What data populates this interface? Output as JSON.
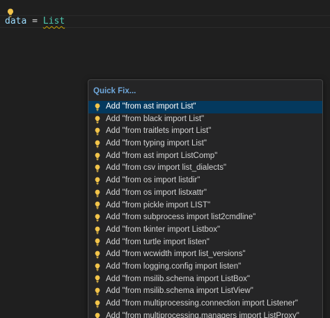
{
  "editor": {
    "code": {
      "var": "data",
      "op": " = ",
      "type": "List"
    },
    "lightbulb_icon": "lightbulb-icon",
    "warning_color": "#cca700"
  },
  "quickfix": {
    "title": "Quick Fix...",
    "selected_index": 0,
    "items": [
      {
        "label": "Add \"from ast import List\"",
        "icon": "lightbulb-icon"
      },
      {
        "label": "Add \"from black import List\"",
        "icon": "lightbulb-icon"
      },
      {
        "label": "Add \"from traitlets import List\"",
        "icon": "lightbulb-icon"
      },
      {
        "label": "Add \"from typing import List\"",
        "icon": "lightbulb-icon"
      },
      {
        "label": "Add \"from ast import ListComp\"",
        "icon": "lightbulb-icon"
      },
      {
        "label": "Add \"from csv import list_dialects\"",
        "icon": "lightbulb-icon"
      },
      {
        "label": "Add \"from os import listdir\"",
        "icon": "lightbulb-icon"
      },
      {
        "label": "Add \"from os import listxattr\"",
        "icon": "lightbulb-icon"
      },
      {
        "label": "Add \"from pickle import LIST\"",
        "icon": "lightbulb-icon"
      },
      {
        "label": "Add \"from subprocess import list2cmdline\"",
        "icon": "lightbulb-icon"
      },
      {
        "label": "Add \"from tkinter import Listbox\"",
        "icon": "lightbulb-icon"
      },
      {
        "label": "Add \"from turtle import listen\"",
        "icon": "lightbulb-icon"
      },
      {
        "label": "Add \"from wcwidth import list_versions\"",
        "icon": "lightbulb-icon"
      },
      {
        "label": "Add \"from logging.config import listen\"",
        "icon": "lightbulb-icon"
      },
      {
        "label": "Add \"from msilib.schema import ListBox\"",
        "icon": "lightbulb-icon"
      },
      {
        "label": "Add \"from msilib.schema import ListView\"",
        "icon": "lightbulb-icon"
      },
      {
        "label": "Add \"from multiprocessing.connection import Listener\"",
        "icon": "lightbulb-icon"
      },
      {
        "label": "Add \"from multiprocessing.managers import ListProxy\"",
        "icon": "lightbulb-icon"
      }
    ],
    "colors": {
      "header": "#6fa8dc",
      "selection": "#04395e",
      "bulb": "#f2c44a"
    }
  }
}
